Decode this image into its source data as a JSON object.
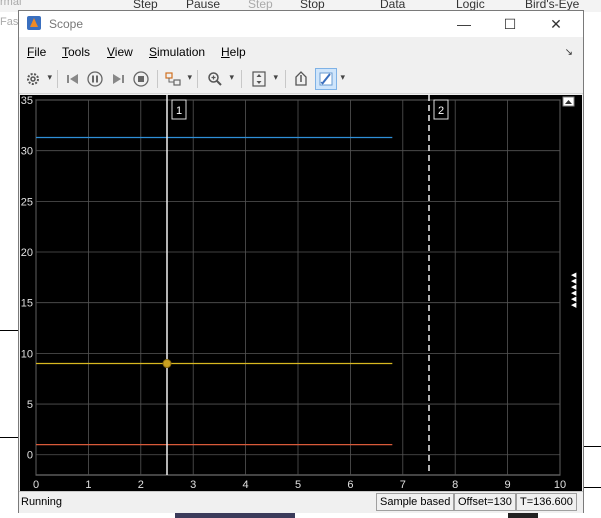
{
  "background": {
    "toolbar_labels": [
      "Step",
      "Pause",
      "Step",
      "Stop",
      "Data",
      "Logic",
      "Bird's-Eye"
    ],
    "left_labels": [
      "rmal",
      "Fas"
    ]
  },
  "window": {
    "title": "Scope"
  },
  "menu": [
    "File",
    "Tools",
    "View",
    "Simulation",
    "Help"
  ],
  "toolbar_icons": [
    "gear-icon",
    "step-back-icon",
    "pause-icon",
    "step-forward-icon",
    "stop-icon",
    "highlight-icon",
    "zoom-in-icon",
    "autoscale-icon",
    "undock-icon",
    "cursor-measurements-icon"
  ],
  "chart_data": {
    "type": "line",
    "xlim": [
      0,
      10
    ],
    "ylim": [
      -2,
      35
    ],
    "x_ticks": [
      "0",
      "1",
      "2",
      "3",
      "4",
      "5",
      "6",
      "7",
      "8",
      "9",
      "10"
    ],
    "y_ticks": [
      "0",
      "5",
      "10",
      "15",
      "20",
      "25",
      "30",
      "35"
    ],
    "grid": true,
    "series": [
      {
        "color": "#2e8fd8",
        "x": [
          0,
          6.8
        ],
        "values": [
          31.3,
          31.3
        ]
      },
      {
        "color": "#d8b820",
        "x": [
          0,
          6.8
        ],
        "values": [
          9,
          9
        ]
      },
      {
        "color": "#d85a3a",
        "x": [
          0,
          6.8
        ],
        "values": [
          1,
          1
        ]
      }
    ],
    "cursors": [
      {
        "label": "1",
        "x": 2.5,
        "style": "solid"
      },
      {
        "label": "2",
        "x": 7.5,
        "style": "dashed"
      }
    ],
    "marker": {
      "x": 2.5,
      "y": 9
    }
  },
  "status": {
    "state": "Running",
    "mode": "Sample based",
    "offset": "Offset=130",
    "time": "T=136.600"
  }
}
